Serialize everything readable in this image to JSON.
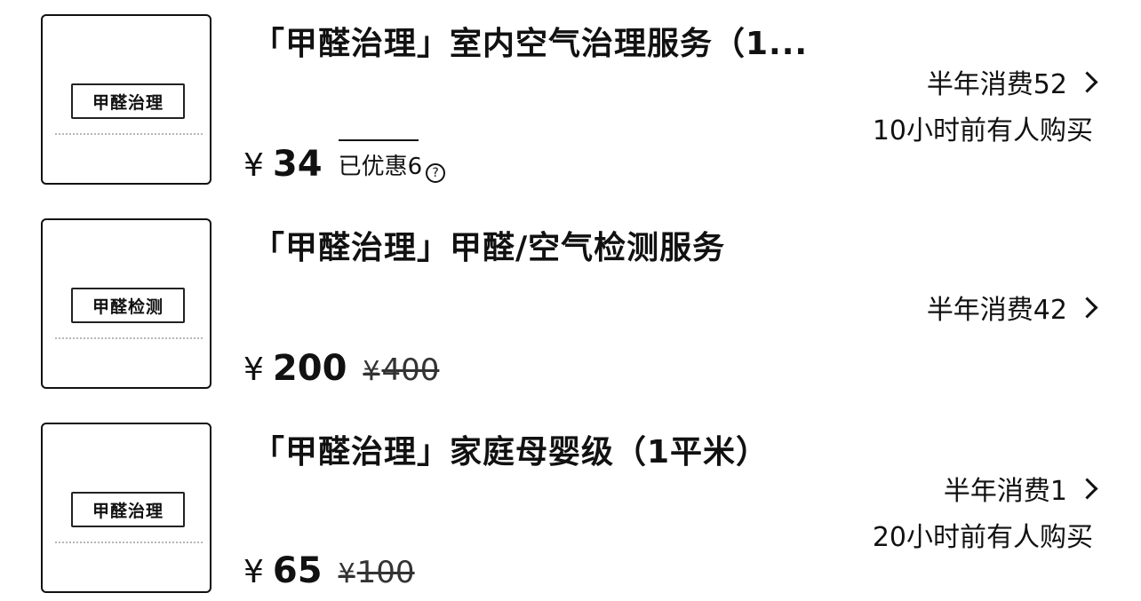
{
  "items": [
    {
      "thumb_label": "甲醛治理",
      "title": "「甲醛治理」室内空气治理服务（1...",
      "sales": "半年消费52",
      "recent": "10小时前有人购买",
      "price_symbol": "¥",
      "price": "34",
      "discount": "已优惠6",
      "info_icon": "info-icon"
    },
    {
      "thumb_label": "甲醛检测",
      "title": "「甲醛治理」甲醛/空气检测服务",
      "sales": "半年消费42",
      "recent": "",
      "price_symbol": "¥",
      "price": "200",
      "orig_symbol": "¥",
      "orig_price": "400"
    },
    {
      "thumb_label": "甲醛治理",
      "title": "「甲醛治理」家庭母婴级（1平米）",
      "sales": "半年消费1",
      "recent": "20小时前有人购买",
      "price_symbol": "¥",
      "price": "65",
      "orig_symbol": "¥",
      "orig_price": "100"
    }
  ]
}
